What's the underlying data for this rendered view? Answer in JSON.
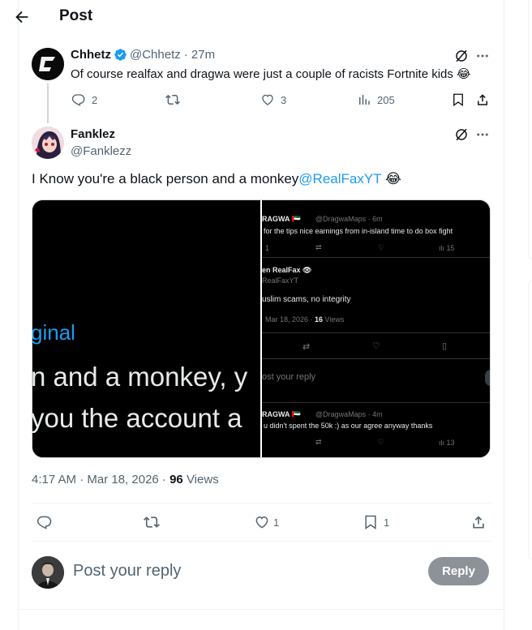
{
  "header": {
    "title": "Post"
  },
  "parent_tweet": {
    "author_name": "Chhetz",
    "handle": "@Chhetz",
    "time": "· 27m",
    "text": "Of course realfax and dragwa were just a couple of racists Fortnite kids 😂",
    "replies": "2",
    "likes": "3",
    "views": "205"
  },
  "main_tweet": {
    "author_name": "Fanklez",
    "handle": "@Fanklezz",
    "text": "I Know you're a black person and a monkey",
    "mention": "@RealFaxYT",
    "emoji": "😂",
    "time": "4:17 AM · Mar 18, 2026 · ",
    "views_count": "96",
    "views_label": " Views",
    "likes": "1",
    "bookmarks": "1"
  },
  "media": {
    "left": {
      "line1": "ginal",
      "line2": "n and a monkey, y",
      "line3": "you the account a"
    },
    "right": {
      "a_name": "RAGWA 🇦🇪",
      "a_handle": "@DragwaMaps · 6m",
      "a_text": "for the tips nice earnings from in-island time to do box fight",
      "a_reply": "1",
      "a_views": "15",
      "b_name": "en RealFax 👁",
      "b_handle": "RealFaxYT",
      "b_text": "uslim scams, no integrity",
      "b_date": "Mar 18, 2026 · ",
      "b_views_n": "16",
      "b_views_l": " Views",
      "reply_ph": "ost your reply",
      "c_name": "RAGWA 🇦🇪",
      "c_handle": "@DragwaMaps · 4m",
      "c_text": "u didn't spent the 50k :) as our agree anyway thanks",
      "c_views": "13"
    }
  },
  "reply_box": {
    "placeholder": "Post your reply",
    "button": "Reply"
  },
  "colors": {
    "accent": "#1d9bf0",
    "muted": "#536471",
    "verified": "#1d9bf0"
  }
}
